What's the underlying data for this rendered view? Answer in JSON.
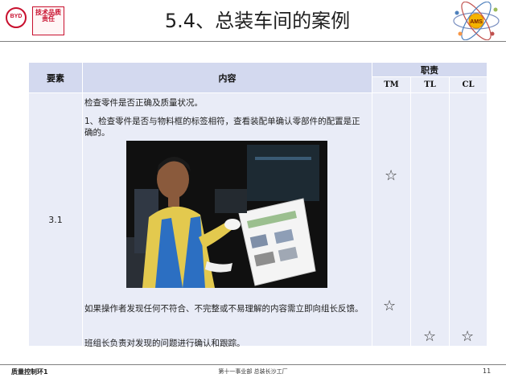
{
  "header": {
    "brand_text": "BYD",
    "seal_text": "技术品质责任",
    "title": "5.4、总装车间的案例",
    "ams_label": "AMS"
  },
  "table": {
    "col_element": "要素",
    "col_content": "内容",
    "col_duty": "职责",
    "duty_roles": [
      "TM",
      "TL",
      "CL"
    ],
    "row": {
      "element": "3.1",
      "line1": "检查零件是否正确及质量状况。",
      "line2": "1、检查零件是否与物料框的标签相符，查看装配单确认零部件的配置是正确的。",
      "line3": "如果操作者发现任何不符合、不完整或不易理解的内容需立即向组长反馈。",
      "line4": "班组长负责对发现的问题进行确认和跟踪。",
      "star_symbol": "☆"
    }
  },
  "footer": {
    "left": "质量控制环1",
    "center": "第十一事业部 总装长沙工厂",
    "page": "11"
  },
  "colors": {
    "header_fill": "#d3d9ef",
    "cell_fill": "#e9ecf7",
    "brand_red": "#c8102e"
  }
}
